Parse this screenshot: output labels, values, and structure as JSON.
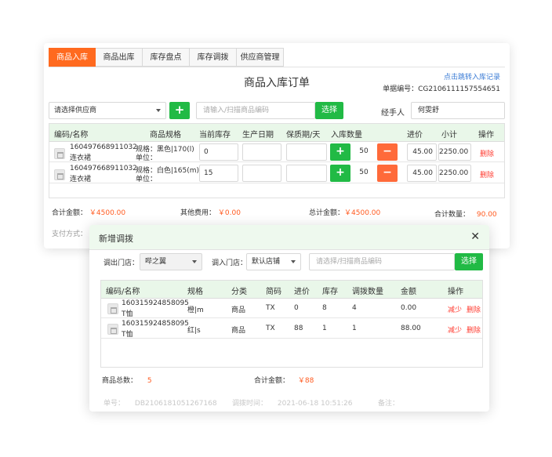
{
  "tabs": [
    "商品入库",
    "商品出库",
    "库存盘点",
    "库存调拨",
    "供应商管理"
  ],
  "order": {
    "title": "商品入库订单",
    "jump_link": "点击跳转入库记录",
    "doc_no_label": "单据编号：",
    "doc_no": "CG2106111157554651",
    "supplier_placeholder": "请选择供应商",
    "search_placeholder": "请输入/扫描商品编码",
    "select_button": "选择",
    "handler_label": "经手人",
    "handler_value": "何雯舒",
    "columns": [
      "编码/名称",
      "商品规格",
      "当前库存",
      "生产日期",
      "保质期/天",
      "入库数量",
      "进价",
      "小计",
      "操作"
    ],
    "rows": [
      {
        "code": "160497668911032",
        "name": "连衣裙",
        "spec": "规格：黑色|170(l)",
        "unit": "单位：",
        "stock": "0",
        "qty": "50",
        "price": "45.00",
        "subtotal": "2250.00",
        "action": "删除"
      },
      {
        "code": "160497668911032",
        "name": "连衣裙",
        "spec": "规格：白色|165(m)",
        "unit": "单位：",
        "stock": "15",
        "qty": "50",
        "price": "45.00",
        "subtotal": "2250.00",
        "action": "删除"
      }
    ],
    "totals": {
      "total_amount_label": "合计金额：",
      "total_amount": "￥4500.00",
      "other_fee_label": "其他费用：",
      "other_fee": "￥0.00",
      "grand_total_label": "总计金额：",
      "grand_total": "￥4500.00",
      "total_qty_label": "合计数量：",
      "total_qty": "90.00"
    },
    "payment_label": "支付方式："
  },
  "modal": {
    "title": "新增调拨",
    "out_store_label": "调出门店：",
    "out_store_value": "哔之翼",
    "in_store_label": "调入门店：",
    "in_store_value": "默认店铺",
    "search_placeholder": "请选择/扫描商品编码",
    "select_button": "选择",
    "columns": [
      "编码/名称",
      "规格",
      "分类",
      "简码",
      "进价",
      "库存",
      "调拨数量",
      "金额",
      "操作"
    ],
    "rows": [
      {
        "code": "160315924858095",
        "name": "T恤",
        "spec": "橙|m",
        "category": "商品",
        "short_code": "TX",
        "price": "0",
        "stock": "8",
        "transfer_qty": "4",
        "amount": "0.00",
        "reduce": "减少",
        "delete": "删除"
      },
      {
        "code": "160315924858095",
        "name": "T恤",
        "spec": "红|s",
        "category": "商品",
        "short_code": "TX",
        "price": "88",
        "stock": "1",
        "transfer_qty": "1",
        "amount": "88.00",
        "reduce": "减少",
        "delete": "删除"
      }
    ],
    "total_count_label": "商品总数：",
    "total_count": "5",
    "total_amount_label": "合计金额：",
    "total_amount": "￥88",
    "footer": {
      "doc_label": "单号：",
      "doc_no": "DB21061810512671​68",
      "time_label": "调拨时间：",
      "time_value": "2021-06-18 10:51:26",
      "note_label": "备注："
    }
  },
  "colors": {
    "accent_orange": "#ff6a1f",
    "green": "#21ba45",
    "header_green": "#e9f7e9",
    "delete_red": "#ff3b30"
  }
}
